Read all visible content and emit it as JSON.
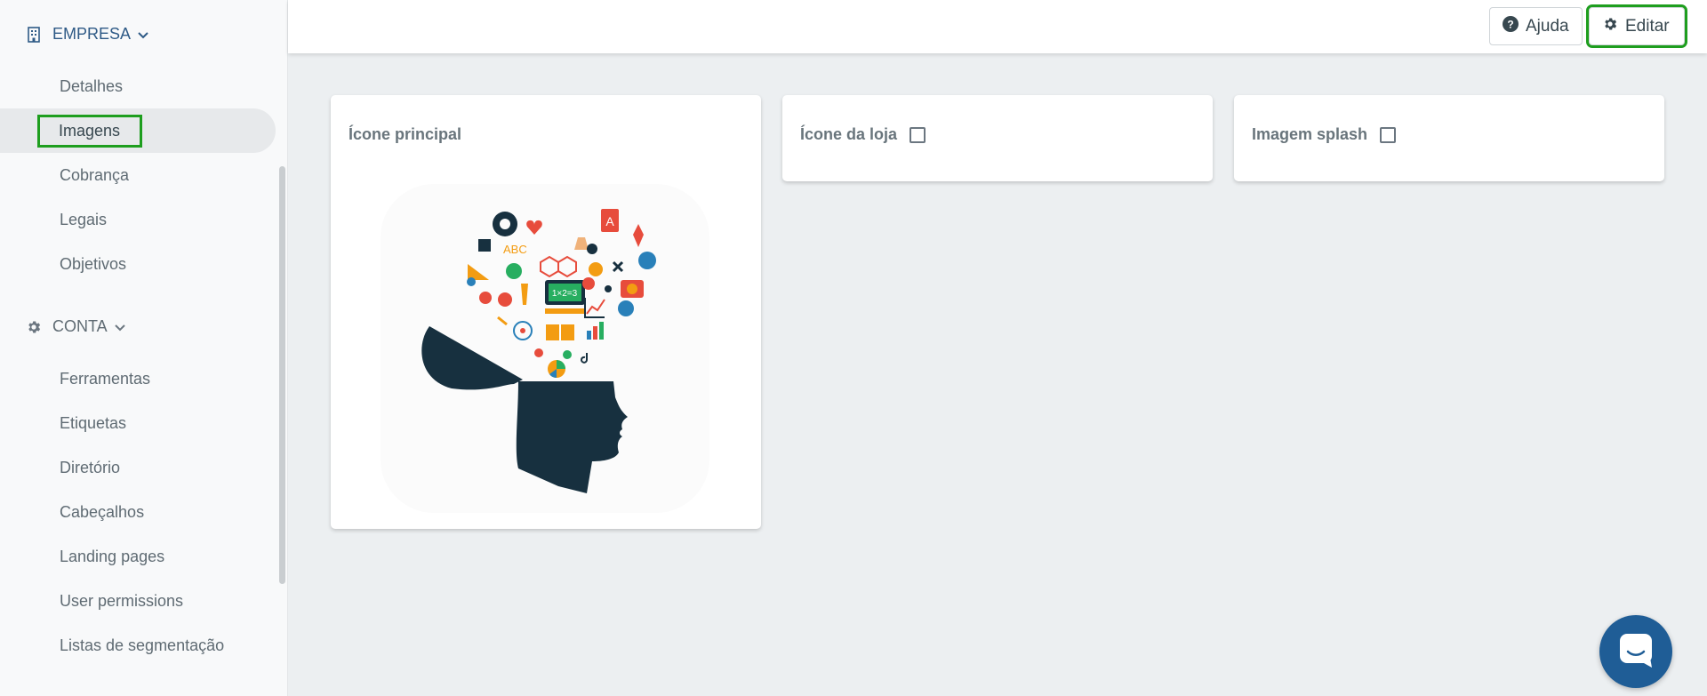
{
  "sidebar": {
    "empresa": {
      "label": "EMPRESA",
      "items": [
        {
          "label": "Detalhes"
        },
        {
          "label": "Imagens"
        },
        {
          "label": "Cobrança"
        },
        {
          "label": "Legais"
        },
        {
          "label": "Objetivos"
        }
      ]
    },
    "conta": {
      "label": "CONTA",
      "items": [
        {
          "label": "Ferramentas"
        },
        {
          "label": "Etiquetas"
        },
        {
          "label": "Diretório"
        },
        {
          "label": "Cabeçalhos"
        },
        {
          "label": "Landing pages"
        },
        {
          "label": "User permissions"
        },
        {
          "label": "Listas de segmentação"
        }
      ]
    },
    "active_item": "Imagens"
  },
  "toolbar": {
    "help_label": "Ajuda",
    "edit_label": "Editar"
  },
  "cards": [
    {
      "title": "Ícone principal",
      "has_image": true
    },
    {
      "title": "Ícone da loja",
      "checkbox_checked": false
    },
    {
      "title": "Imagem splash",
      "checkbox_checked": false
    }
  ],
  "app_icon": {
    "board_text": "1×2=3",
    "letters": "ABC",
    "book_letter": "A"
  },
  "colors": {
    "accent": "#2e5a86",
    "highlight": "#1e9e1e",
    "chat": "#1f5d96",
    "head": "#17303f"
  }
}
